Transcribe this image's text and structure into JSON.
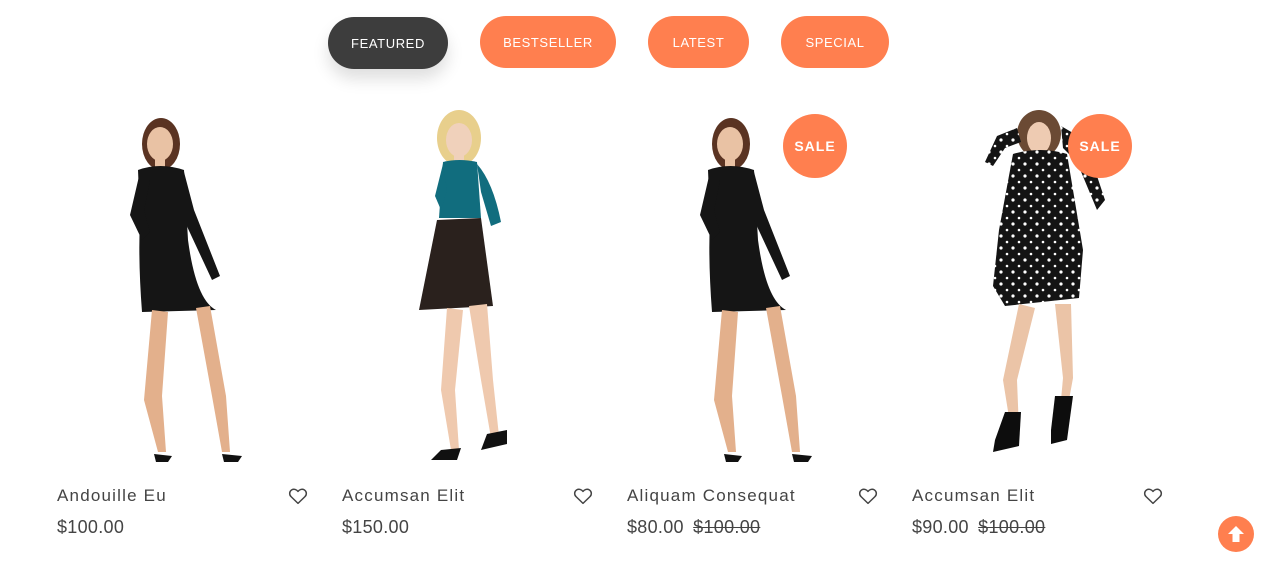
{
  "tabs": [
    {
      "label": "FEATURED",
      "active": true
    },
    {
      "label": "BESTSELLER",
      "active": false
    },
    {
      "label": "LATEST",
      "active": false
    },
    {
      "label": "SPECIAL",
      "active": false
    }
  ],
  "products": [
    {
      "name": "Andouille Eu",
      "price": "$100.00",
      "old_price": "",
      "sale": false,
      "sale_label": "",
      "outfit": "black-dress"
    },
    {
      "name": "Accumsan Elit",
      "price": "$150.00",
      "old_price": "",
      "sale": false,
      "sale_label": "",
      "outfit": "teal-top-leather-skirt"
    },
    {
      "name": "Aliquam Consequat",
      "price": "$80.00",
      "old_price": "$100.00",
      "sale": true,
      "sale_label": "SALE",
      "outfit": "black-dress"
    },
    {
      "name": "Accumsan Elit",
      "price": "$90.00",
      "old_price": "$100.00",
      "sale": true,
      "sale_label": "SALE",
      "outfit": "star-print-dress"
    }
  ],
  "icons": {
    "wishlist": "heart-outline-icon",
    "scroll_top": "arrow-up-circle-icon"
  },
  "colors": {
    "accent": "#ff7f4f",
    "active_tab": "#3d3d3d",
    "text": "#444444"
  }
}
